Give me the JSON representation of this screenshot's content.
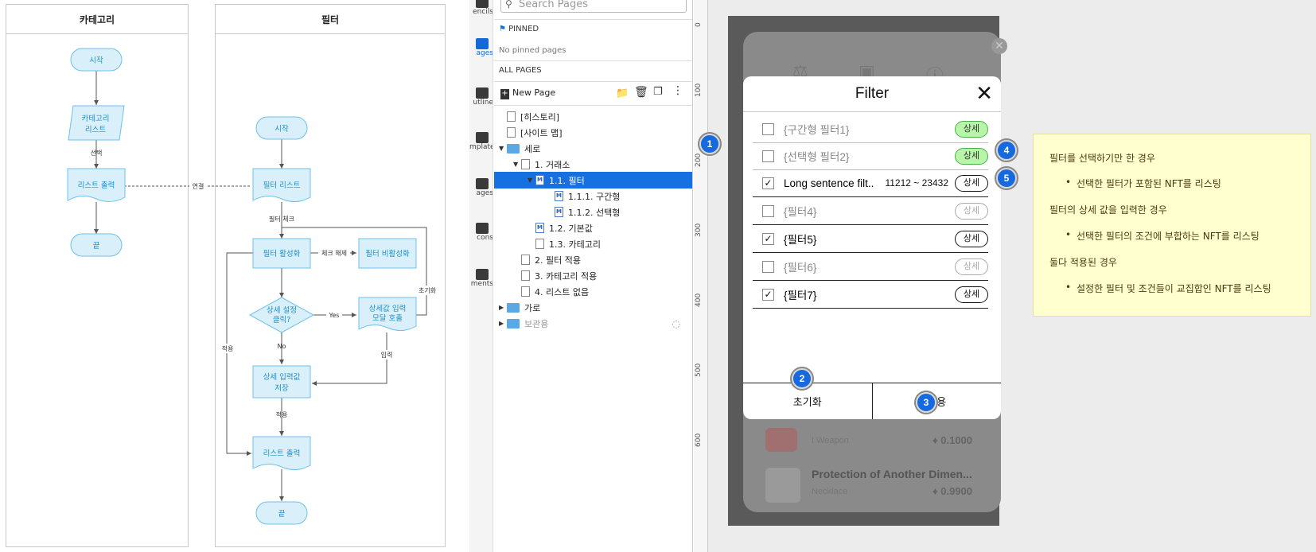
{
  "flowchart": {
    "lanes": [
      "카테고리",
      "필터"
    ],
    "left_nodes": {
      "start": "시작",
      "category_list_1": "카테고리",
      "category_list_2": "리스트",
      "select_label": "선택",
      "list_output": "리스트 출력",
      "end": "끝",
      "link_label": "연결"
    },
    "right_nodes": {
      "start": "시작",
      "filter_list": "필터 리스트",
      "filter_check": "필터 체크",
      "filter_on": "필터 활성화",
      "uncheck": "체크 해제",
      "filter_off": "필터 비활성화",
      "detail_click_1": "상세 설정",
      "detail_click_2": "클릭?",
      "yes": "Yes",
      "modal_1": "상세값 입력",
      "modal_2": "모달 호출",
      "reset": "초기화",
      "no": "No",
      "input": "입력",
      "apply_side": "적용",
      "save_1": "상세 입력값",
      "save_2": "저장",
      "apply": "적용",
      "list_output": "리스트 출력",
      "end": "끝"
    }
  },
  "tools": [
    {
      "label": "encils",
      "icon": "stencils-icon"
    },
    {
      "label": "ages",
      "icon": "pages-icon"
    },
    {
      "label": "utline",
      "icon": "outline-icon"
    },
    {
      "label": "mplates",
      "icon": "templates-icon"
    },
    {
      "label": "ages",
      "icon": "images-icon"
    },
    {
      "label": "cons",
      "icon": "icons-icon"
    },
    {
      "label": "ments",
      "icon": "comments-icon"
    }
  ],
  "pages_panel": {
    "search_placeholder": "Search Pages",
    "pinned_label": "PINNED",
    "no_pinned": "No pinned pages",
    "all_pages": "ALL PAGES",
    "new_page": "New Page",
    "tree": [
      {
        "label": "[히스토리]",
        "kind": "page",
        "depth": 0
      },
      {
        "label": "[사이트 맵]",
        "kind": "page",
        "depth": 0
      },
      {
        "label": "세로",
        "kind": "folder",
        "depth": 0,
        "expanded": true
      },
      {
        "label": "1. 거래소",
        "kind": "page",
        "depth": 1,
        "expanded": true
      },
      {
        "label": "1.1. 필터",
        "kind": "mpage",
        "depth": 2,
        "expanded": true,
        "selected": true
      },
      {
        "label": "1.1.1. 구간형",
        "kind": "mpage",
        "depth": 3
      },
      {
        "label": "1.1.2. 선택형",
        "kind": "mpage",
        "depth": 3
      },
      {
        "label": "1.2. 기본값",
        "kind": "mpage",
        "depth": 2
      },
      {
        "label": "1.3. 카테고리",
        "kind": "page",
        "depth": 2
      },
      {
        "label": "2. 필터 적용",
        "kind": "page",
        "depth": 1
      },
      {
        "label": "3. 카테고리 적용",
        "kind": "page",
        "depth": 1
      },
      {
        "label": "4. 리스트 없음",
        "kind": "page",
        "depth": 1
      },
      {
        "label": "가로",
        "kind": "folder",
        "depth": 0,
        "expanded": false
      },
      {
        "label": "보관용",
        "kind": "folder",
        "depth": 0,
        "expanded": false,
        "hidden": true
      }
    ]
  },
  "ruler": [
    "0",
    "100",
    "200",
    "300",
    "400",
    "500",
    "600"
  ],
  "modal": {
    "title": "Filter",
    "rows": [
      {
        "label": "{구간형 필터1}",
        "checked": false,
        "range": "",
        "button": "상세",
        "style": "green"
      },
      {
        "label": "{선택형 필터2}",
        "checked": false,
        "range": "",
        "button": "상세",
        "style": "green"
      },
      {
        "label": "Long sentence filt..",
        "checked": true,
        "range": "11212 ~ 23432",
        "button": "상세",
        "style": "normal"
      },
      {
        "label": "{필터4}",
        "checked": false,
        "range": "",
        "button": "상세",
        "style": "grey"
      },
      {
        "label": "{필터5}",
        "checked": true,
        "range": "",
        "button": "상세",
        "style": "normal"
      },
      {
        "label": "{필터6}",
        "checked": false,
        "range": "",
        "button": "상세",
        "style": "grey"
      },
      {
        "label": "{필터7}",
        "checked": true,
        "range": "",
        "button": "상세",
        "style": "normal"
      }
    ],
    "reset": "초기화",
    "apply": "적용",
    "badges": [
      "1",
      "2",
      "3",
      "4",
      "5"
    ]
  },
  "background_items": [
    {
      "name": "I Weapon",
      "price": "0.1000"
    },
    {
      "name": "Protection of Another Dimen...",
      "sub": "Necklace",
      "price": "0.9900"
    }
  ],
  "note": {
    "l1": "필터를 선택하기만 한 경우",
    "b1": "선택한 필터가 포함된 NFT를 리스팅",
    "l2": "필터의 상세 값을 입력한 경우",
    "b2": "선택한 필터의 조건에 부합하는 NFT를 리스팅",
    "l3": "둘다 적용된 경우",
    "b3": "설정한 필터 및 조건들이 교집합인 NFT를 리스팅"
  },
  "colors": {
    "accent": "#1770e0",
    "flow": "#1e8fc8",
    "flow_fill": "#d9f0fb",
    "green": "#b8f5a8",
    "note": "#ffffcf"
  }
}
